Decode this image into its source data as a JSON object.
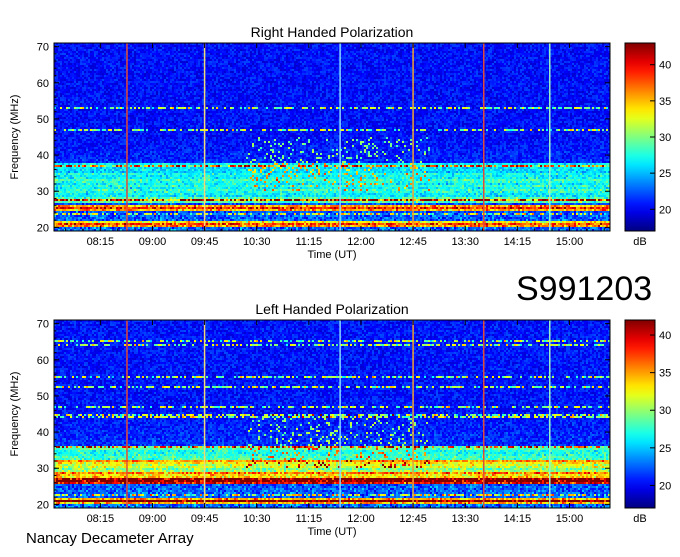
{
  "figure": {
    "observation_id": "S991203",
    "instrument": "Nancay Decameter Array"
  },
  "chart_data": [
    {
      "type": "heatmap",
      "title": "Right Handed Polarization",
      "xlabel": "Time (UT)",
      "ylabel": "Frequency (MHz)",
      "x_ticks": [
        "08:15",
        "09:00",
        "09:45",
        "10:30",
        "11:15",
        "12:00",
        "12:45",
        "13:30",
        "14:15",
        "15:00"
      ],
      "x_tick_minutes": [
        495,
        540,
        585,
        630,
        675,
        720,
        765,
        810,
        855,
        900
      ],
      "xlim_minutes": [
        455,
        935
      ],
      "y_ticks": [
        20,
        30,
        40,
        50,
        60,
        70
      ],
      "ylim": [
        19,
        71
      ],
      "colorbar": {
        "label": "dB",
        "ticks": [
          20,
          25,
          30,
          35,
          40
        ],
        "range": [
          17,
          43
        ]
      },
      "vertical_lines": [
        {
          "time_minutes": 518,
          "color": "#e04a3a"
        },
        {
          "time_minutes": 585,
          "color": "#f0d878"
        },
        {
          "time_minutes": 702,
          "color": "#8ad8ff"
        },
        {
          "time_minutes": 765,
          "color": "#f0a030"
        },
        {
          "time_minutes": 826,
          "color": "#e04a3a"
        },
        {
          "time_minutes": 883,
          "color": "#9af0c8"
        }
      ],
      "emission_bands_mhz": [
        [
          20,
          22
        ],
        [
          24.5,
          26
        ],
        [
          26.5,
          28
        ],
        [
          28,
          31
        ],
        [
          31,
          34
        ],
        [
          34,
          38
        ]
      ]
    },
    {
      "type": "heatmap",
      "title": "Left Handed Polarization",
      "xlabel": "Time (UT)",
      "ylabel": "Frequency (MHz)",
      "x_ticks": [
        "08:15",
        "09:00",
        "09:45",
        "10:30",
        "11:15",
        "12:00",
        "12:45",
        "13:30",
        "14:15",
        "15:00"
      ],
      "x_tick_minutes": [
        495,
        540,
        585,
        630,
        675,
        720,
        765,
        810,
        855,
        900
      ],
      "xlim_minutes": [
        455,
        935
      ],
      "y_ticks": [
        20,
        30,
        40,
        50,
        60,
        70
      ],
      "ylim": [
        19,
        71
      ],
      "colorbar": {
        "label": "dB",
        "ticks": [
          20,
          25,
          30,
          35,
          40
        ],
        "range": [
          17,
          42
        ]
      },
      "vertical_lines": [
        {
          "time_minutes": 518,
          "color": "#e04a3a"
        },
        {
          "time_minutes": 585,
          "color": "#f0d878"
        },
        {
          "time_minutes": 702,
          "color": "#8ad8ff"
        },
        {
          "time_minutes": 765,
          "color": "#f0a030"
        },
        {
          "time_minutes": 826,
          "color": "#e04a3a"
        },
        {
          "time_minutes": 883,
          "color": "#9af0c8"
        }
      ],
      "emission_bands_mhz": [
        [
          20,
          22
        ],
        [
          25.5,
          29
        ],
        [
          29,
          32
        ],
        [
          32,
          36
        ]
      ]
    }
  ]
}
